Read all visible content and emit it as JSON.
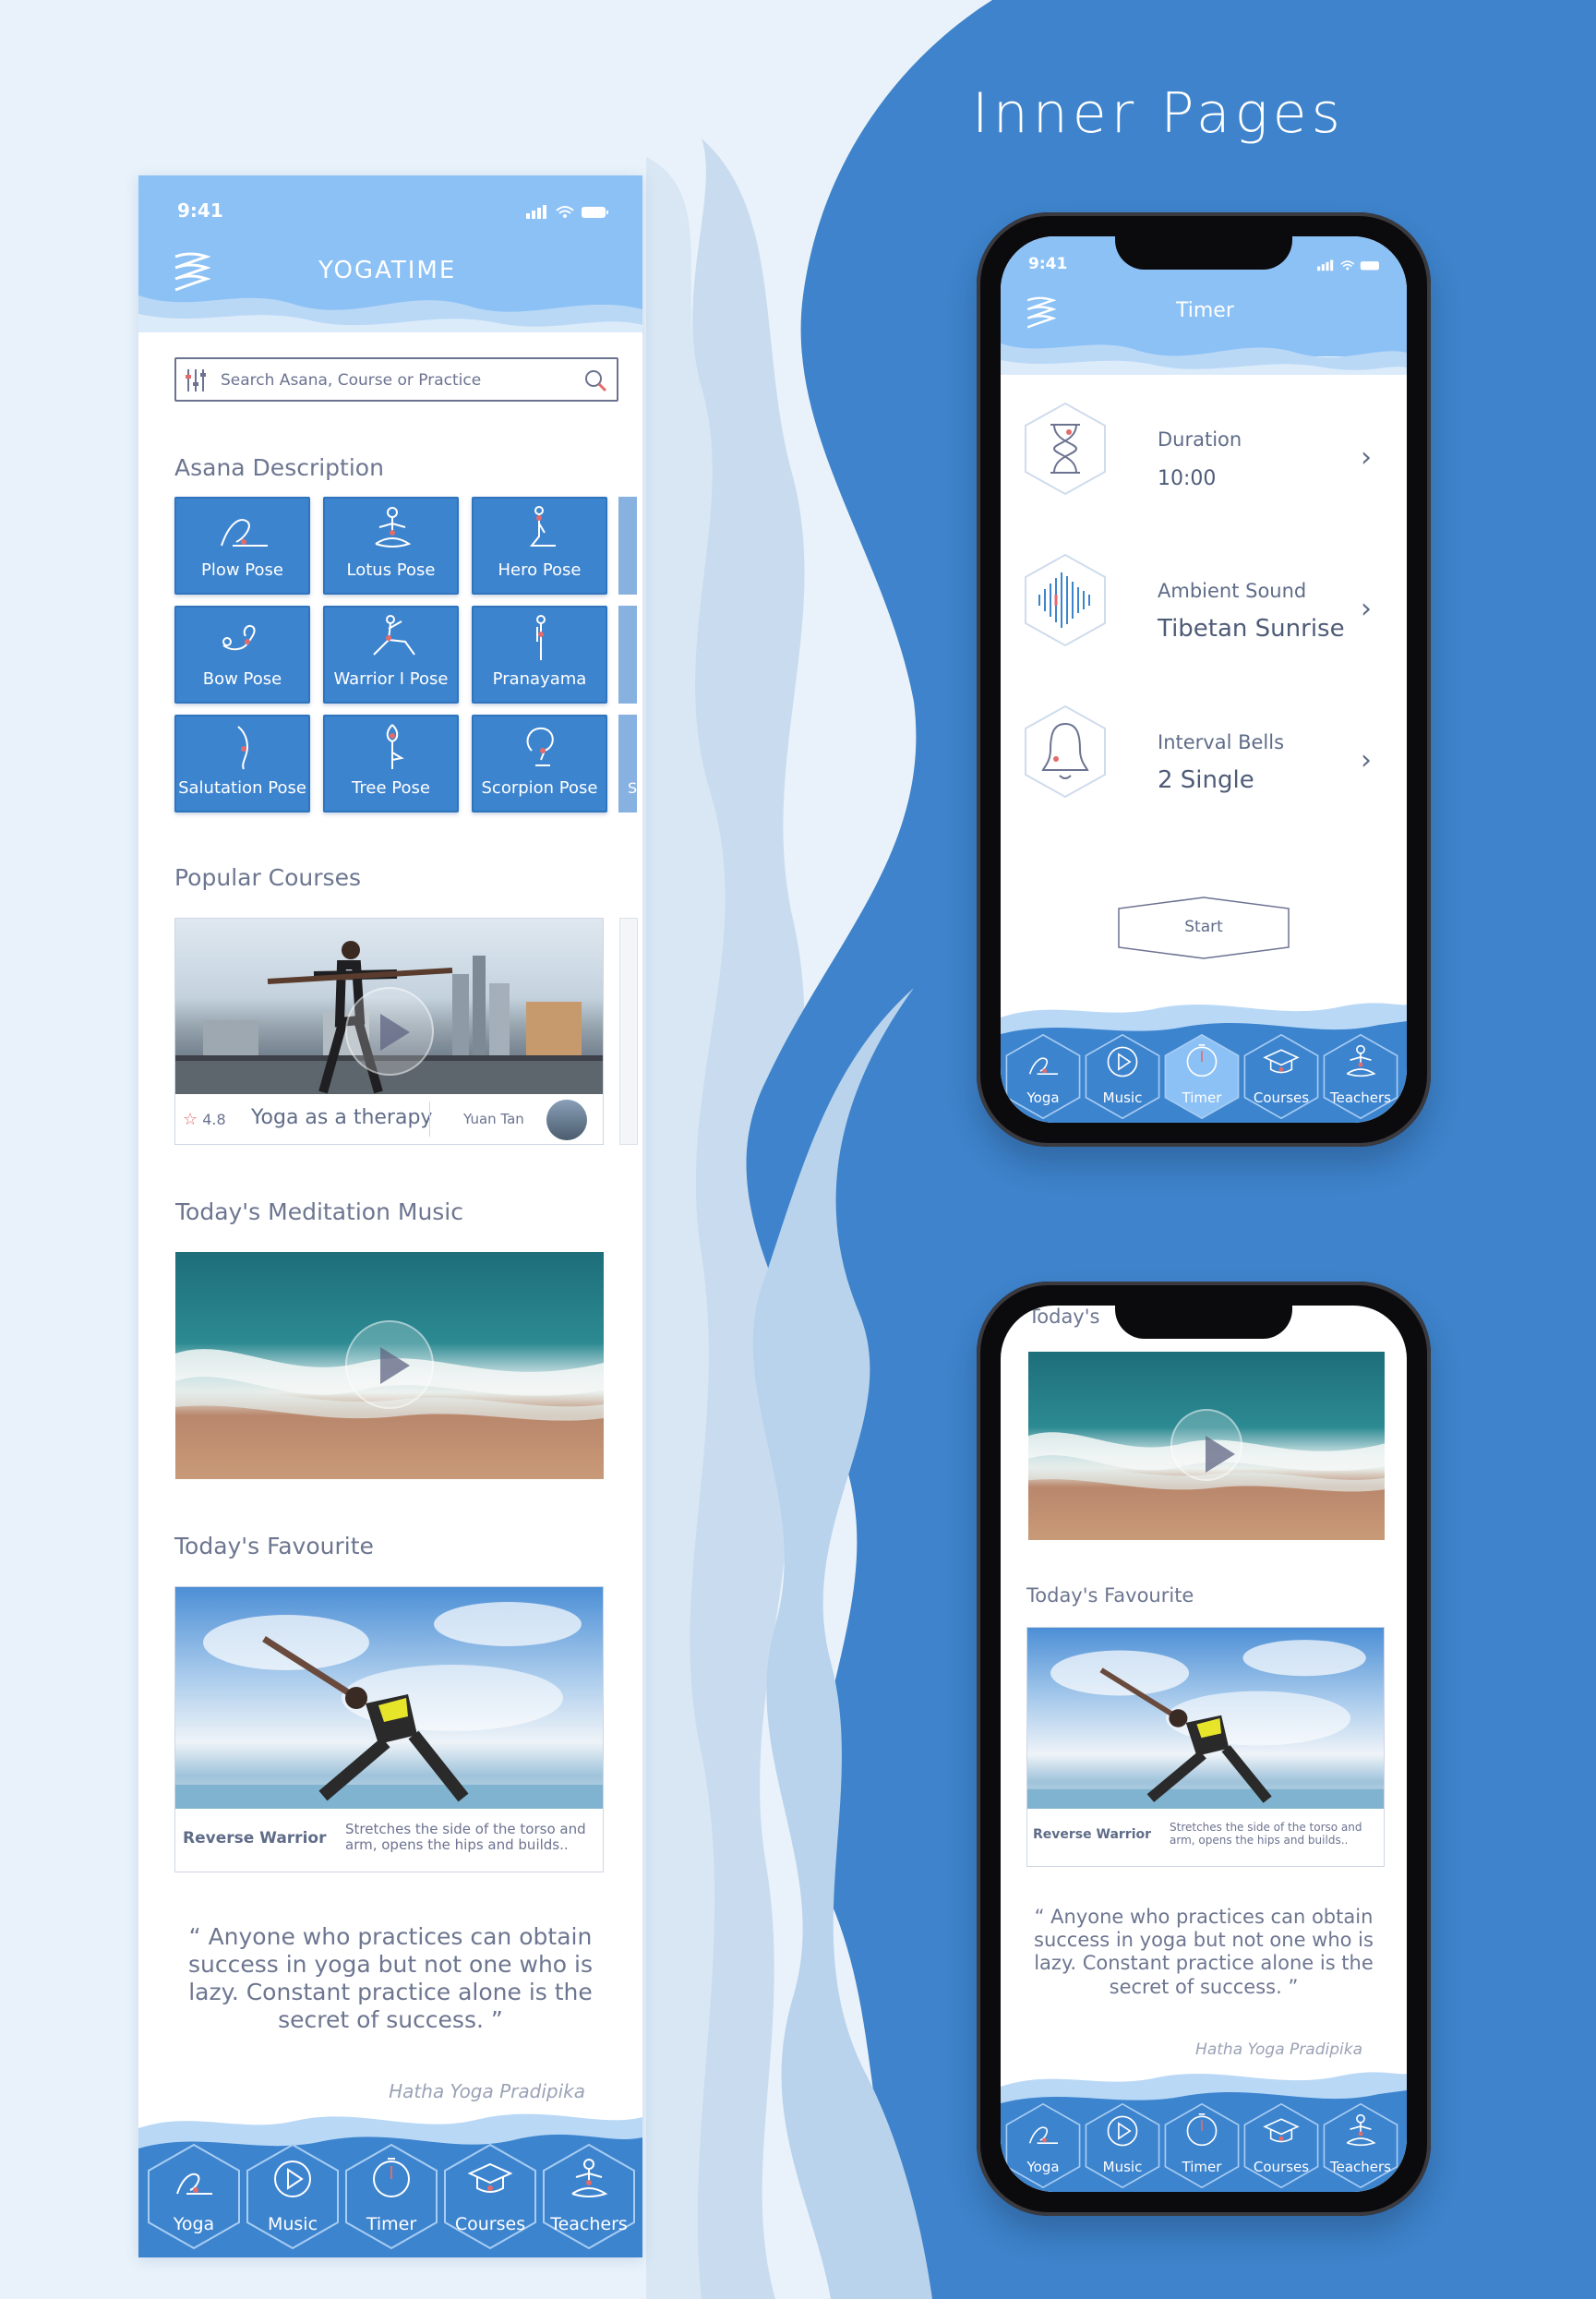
{
  "page": {
    "heading": "Inner Pages"
  },
  "colors": {
    "primary": "#3d84cf",
    "light": "#8cc1f5",
    "background": "#e9f2fa",
    "text": "#5f6c88"
  },
  "home": {
    "status_time": "9:41",
    "app_title": "YOGATIME",
    "search_placeholder": "Search Asana, Course or Practice",
    "asana_title": "Asana Description",
    "asanas": [
      {
        "label": "Plow Pose",
        "icon": "plow-pose-icon"
      },
      {
        "label": "Lotus Pose",
        "icon": "lotus-pose-icon"
      },
      {
        "label": "Hero Pose",
        "icon": "hero-pose-icon"
      },
      {
        "label": "Bow Pose",
        "icon": "bow-pose-icon"
      },
      {
        "label": "Warrior I Pose",
        "icon": "warrior-pose-icon"
      },
      {
        "label": "Pranayama",
        "icon": "pranayama-icon"
      },
      {
        "label": "Salutation Pose",
        "icon": "salutation-pose-icon"
      },
      {
        "label": "Tree Pose",
        "icon": "tree-pose-icon"
      },
      {
        "label": "Scorpion Pose",
        "icon": "scorpion-pose-icon"
      }
    ],
    "asana_peek_label": "Si",
    "courses_title": "Popular Courses",
    "course": {
      "rating": "4.8",
      "name": "Yoga as a therapy",
      "author": "Yuan Tan"
    },
    "music_title": "Today's Meditation Music",
    "favourite_title": "Today's Favourite",
    "favourite": {
      "name": "Reverse Warrior",
      "desc_line1": "Stretches the side of the torso and",
      "desc_line2": "arm, opens the hips and builds.."
    },
    "quote_lines": [
      "“ Anyone who practices can obtain",
      "success in yoga but not one who is",
      "lazy. Constant practice alone is the",
      "secret of success. ”"
    ],
    "quote_author": "Hatha Yoga Pradipika"
  },
  "nav": [
    {
      "label": "Yoga",
      "icon": "yoga-icon"
    },
    {
      "label": "Music",
      "icon": "music-play-icon"
    },
    {
      "label": "Timer",
      "icon": "timer-icon"
    },
    {
      "label": "Courses",
      "icon": "courses-icon"
    },
    {
      "label": "Teachers",
      "icon": "teachers-icon"
    }
  ],
  "timer": {
    "status_time": "9:41",
    "title": "Timer",
    "rows": [
      {
        "label": "Duration",
        "value": "10:00",
        "icon": "hourglass-icon"
      },
      {
        "label": "Ambient Sound",
        "value": "Tibetan Sunrise",
        "icon": "soundwave-icon"
      },
      {
        "label": "Interval Bells",
        "value": "2 Single",
        "icon": "bell-icon"
      }
    ],
    "start_label": "Start",
    "active_tab": "Timer"
  },
  "phone2": {
    "partial_title": "Today's",
    "favourite_title": "Today's Favourite"
  }
}
